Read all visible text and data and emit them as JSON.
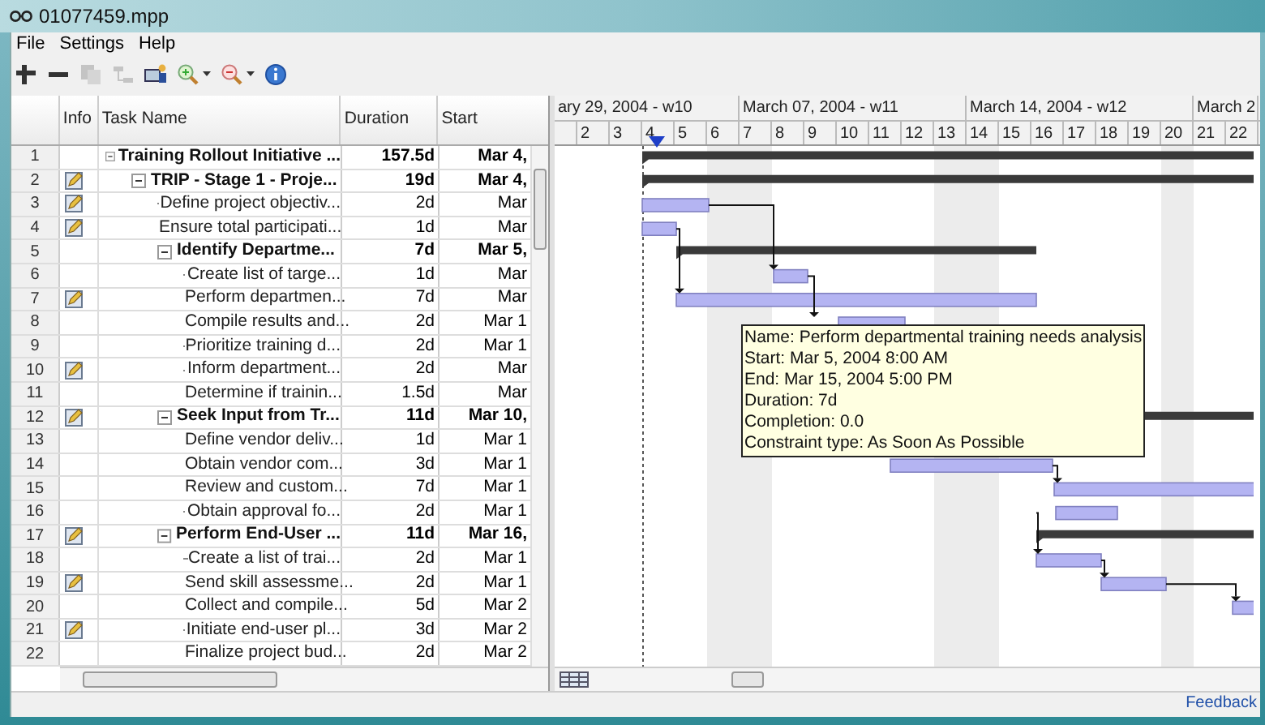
{
  "window": {
    "title": "01077459.mpp"
  },
  "menu": [
    {
      "label": "File"
    },
    {
      "label": "Settings"
    },
    {
      "label": "Help"
    }
  ],
  "toolbar": [
    {
      "kind": "add",
      "disabled": false
    },
    {
      "kind": "remove",
      "disabled": false
    },
    {
      "kind": "copy",
      "disabled": true
    },
    {
      "kind": "link",
      "disabled": true
    },
    {
      "kind": "resource",
      "disabled": false
    },
    {
      "kind": "zoom-in",
      "disabled": false
    },
    {
      "kind": "zoom-out",
      "disabled": false
    },
    {
      "kind": "info",
      "disabled": false
    }
  ],
  "table": {
    "columns": [
      "Info",
      "Task Name",
      "Duration",
      "Start"
    ],
    "tasks": [
      {
        "number": "1",
        "note": false,
        "name": "Training Rollout Initiative ...",
        "duration": "157.5d",
        "start": "Mar 4,",
        "expanded": true,
        "children": [
          {
            "number": "2",
            "note": true,
            "name": "TRIP - Stage 1 - Proje...",
            "duration": "19d",
            "start": "Mar 4,",
            "expanded": true,
            "children": [
              {
                "number": "3",
                "note": true,
                "name": "Define project objectiv...",
                "duration": "2d",
                "start": "Mar"
              },
              {
                "number": "4",
                "note": true,
                "name": "Ensure total participati...",
                "duration": "1d",
                "start": "Mar"
              },
              {
                "number": "5",
                "note": false,
                "name": "Identify Departme...",
                "duration": "7d",
                "start": "Mar 5,",
                "expanded": true,
                "children": [
                  {
                    "number": "6",
                    "note": false,
                    "name": "Create list of targe...",
                    "duration": "1d",
                    "start": "Mar"
                  },
                  {
                    "number": "7",
                    "note": true,
                    "name": "Perform departmen...",
                    "duration": "7d",
                    "start": "Mar"
                  },
                  {
                    "number": "8",
                    "note": false,
                    "name": "Compile results and...",
                    "duration": "2d",
                    "start": "Mar 1"
                  },
                  {
                    "number": "9",
                    "note": false,
                    "name": "Prioritize training d...",
                    "duration": "2d",
                    "start": "Mar 1"
                  },
                  {
                    "number": "10",
                    "note": true,
                    "name": "Inform department...",
                    "duration": "2d",
                    "start": "Mar"
                  },
                  {
                    "number": "11",
                    "note": false,
                    "name": "Determine if trainin...",
                    "duration": "1.5d",
                    "start": "Mar"
                  }
                ]
              },
              {
                "number": "12",
                "note": true,
                "name": "Seek Input from Tr...",
                "duration": "11d",
                "start": "Mar 10,",
                "expanded": true,
                "children": [
                  {
                    "number": "13",
                    "note": false,
                    "name": "Define vendor deliv...",
                    "duration": "1d",
                    "start": "Mar 1"
                  },
                  {
                    "number": "14",
                    "note": false,
                    "name": "Obtain vendor com...",
                    "duration": "3d",
                    "start": "Mar 1"
                  },
                  {
                    "number": "15",
                    "note": false,
                    "name": "Review and custom...",
                    "duration": "7d",
                    "start": "Mar 1"
                  },
                  {
                    "number": "16",
                    "note": false,
                    "name": "Obtain approval fo...",
                    "duration": "2d",
                    "start": "Mar 1"
                  }
                ]
              },
              {
                "number": "17",
                "note": true,
                "name": "Perform End-User ...",
                "duration": "11d",
                "start": "Mar 16,",
                "expanded": true,
                "children": [
                  {
                    "number": "18",
                    "note": false,
                    "name": "Create a list of trai...",
                    "duration": "2d",
                    "start": "Mar 1"
                  },
                  {
                    "number": "19",
                    "note": true,
                    "name": "Send skill assessme...",
                    "duration": "2d",
                    "start": "Mar 1"
                  },
                  {
                    "number": "20",
                    "note": false,
                    "name": "Collect and compile...",
                    "duration": "5d",
                    "start": "Mar 2"
                  },
                  {
                    "number": "21",
                    "note": true,
                    "name": "Initiate end-user pl...",
                    "duration": "3d",
                    "start": "Mar 2"
                  },
                  {
                    "number": "22",
                    "note": false,
                    "name": "Finalize project bud...",
                    "duration": "2d",
                    "start": "Mar 2"
                  }
                ]
              }
            ]
          }
        ]
      }
    ]
  },
  "gantt": {
    "weeks": [
      "ary 29, 2004 - w10",
      "March 07, 2004 - w11",
      "March 14, 2004 - w12",
      "March 2"
    ],
    "days": [
      {
        "label": "2",
        "weekend": false
      },
      {
        "label": "3",
        "weekend": false
      },
      {
        "label": "4",
        "weekend": false
      },
      {
        "label": "5",
        "weekend": false
      },
      {
        "label": "6",
        "weekend": true
      },
      {
        "label": "7",
        "weekend": true
      },
      {
        "label": "8",
        "weekend": false
      },
      {
        "label": "9",
        "weekend": false
      },
      {
        "label": "10",
        "weekend": false
      },
      {
        "label": "11",
        "weekend": false
      },
      {
        "label": "12",
        "weekend": false
      },
      {
        "label": "13",
        "weekend": true
      },
      {
        "label": "14",
        "weekend": true
      },
      {
        "label": "15",
        "weekend": false
      },
      {
        "label": "16",
        "weekend": false
      },
      {
        "label": "17",
        "weekend": false
      },
      {
        "label": "18",
        "weekend": false
      },
      {
        "label": "19",
        "weekend": false
      },
      {
        "label": "20",
        "weekend": true
      },
      {
        "label": "21",
        "weekend": false
      },
      {
        "label": "22",
        "weekend": false
      }
    ],
    "tooltip": [
      "Name: Perform departmental training needs analysis",
      "Start: Mar 5, 2004 8:00 AM",
      "End: Mar 15, 2004 5:00 PM",
      "Duration: 7d",
      "Completion: 0.0",
      "Constraint type: As Soon As Possible"
    ]
  },
  "status_bar": {
    "link": "Feedback"
  }
}
